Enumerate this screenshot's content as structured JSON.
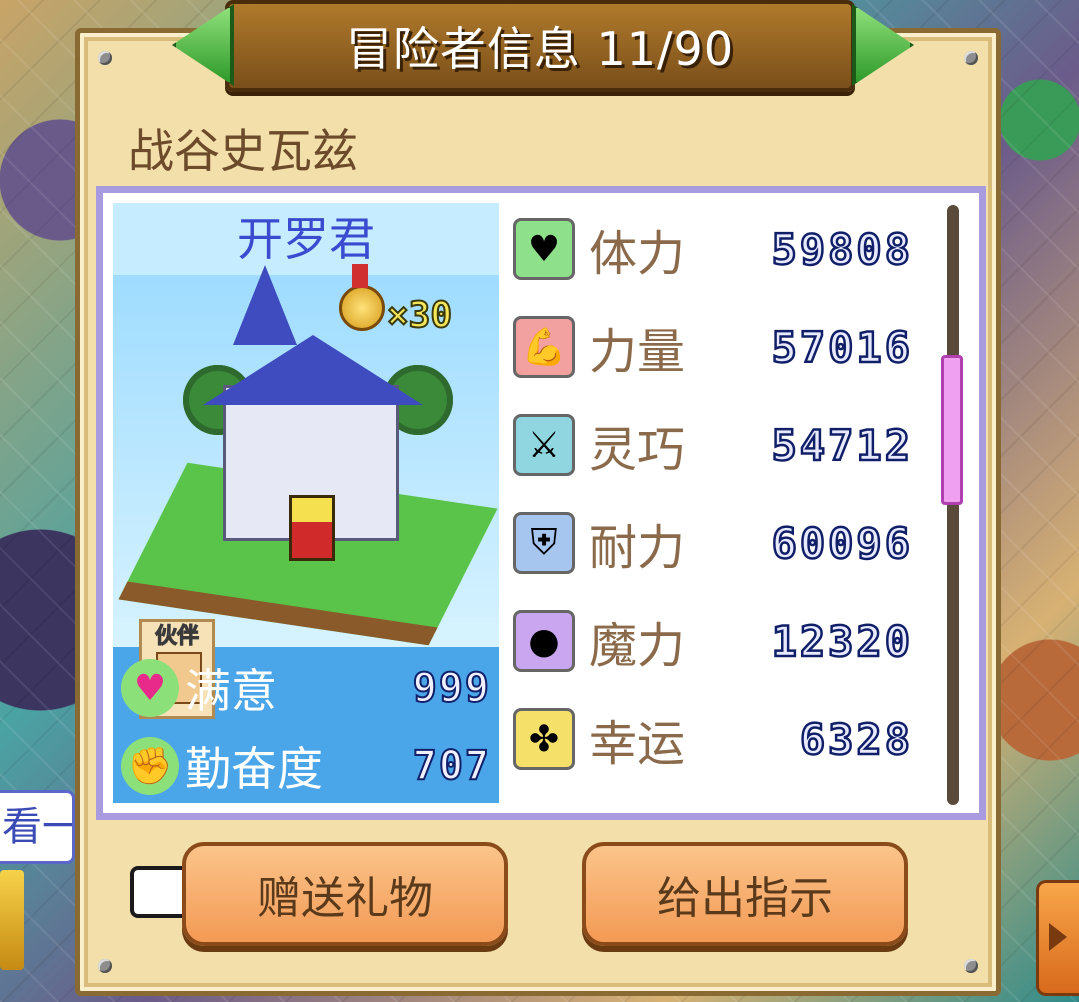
{
  "header": {
    "title": "冒险者信息 11/90"
  },
  "adventurer": {
    "name": "战谷史瓦兹"
  },
  "card": {
    "title": "开罗君",
    "medal_count": "×30",
    "partner_label": "伙伴",
    "satisfaction": {
      "label": "满意",
      "value": "999"
    },
    "diligence": {
      "label": "勤奋度",
      "value": "707"
    }
  },
  "stats": [
    {
      "label": "体力",
      "value": "59808",
      "icon": "heart-icon",
      "color": "#8ee08a"
    },
    {
      "label": "力量",
      "value": "57016",
      "icon": "arm-icon",
      "color": "#f2a0a0"
    },
    {
      "label": "灵巧",
      "value": "54712",
      "icon": "crossed-swords-icon",
      "color": "#8fd6e0"
    },
    {
      "label": "耐力",
      "value": "60096",
      "icon": "shield-icon",
      "color": "#a6c6f0"
    },
    {
      "label": "魔力",
      "value": "12320",
      "icon": "orb-icon",
      "color": "#cba6f0"
    },
    {
      "label": "幸运",
      "value": "6328",
      "icon": "clover-icon",
      "color": "#f5e06a"
    }
  ],
  "buttons": {
    "gift": "赠送礼物",
    "order": "给出指示"
  },
  "side": {
    "left_label": "看一"
  },
  "scroll": {
    "position": 0.25
  }
}
